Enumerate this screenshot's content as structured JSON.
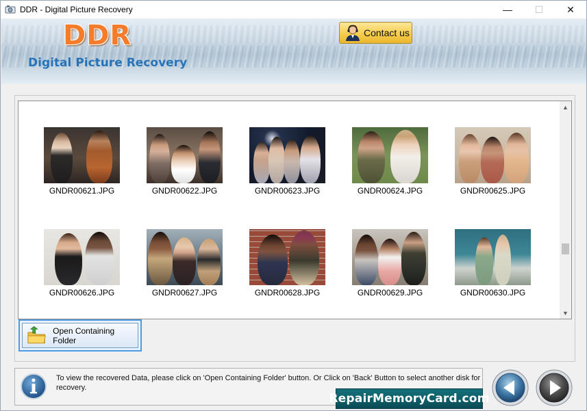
{
  "window": {
    "title": "DDR - Digital Picture Recovery",
    "minimize_glyph": "—",
    "maximize_glyph": "☐",
    "close_glyph": "✕"
  },
  "header": {
    "logo": "DDR",
    "subtitle": "Digital Picture Recovery",
    "contact_label": "Contact us"
  },
  "gallery": {
    "items": [
      {
        "file": "GNDR00621.JPG"
      },
      {
        "file": "GNDR00622.JPG"
      },
      {
        "file": "GNDR00623.JPG"
      },
      {
        "file": "GNDR00624.JPG"
      },
      {
        "file": "GNDR00625.JPG"
      },
      {
        "file": "GNDR00626.JPG"
      },
      {
        "file": "GNDR00627.JPG"
      },
      {
        "file": "GNDR00628.JPG"
      },
      {
        "file": "GNDR00629.JPG"
      },
      {
        "file": "GNDR00630.JPG"
      }
    ]
  },
  "actions": {
    "open_folder_label": "Open Containing Folder"
  },
  "footer": {
    "message": "To view the recovered Data, please click on 'Open Containing Folder' button. Or Click on 'Back' Button to select another disk for recovery.",
    "brand": "RepairMemoryCard.com"
  },
  "colors": {
    "logo_orange": "#f57c2a",
    "subtitle_blue": "#2773b8",
    "contact_gold": "#f6cd4e",
    "brand_teal": "#0d5c66",
    "selection_blue": "#4a9be0"
  }
}
